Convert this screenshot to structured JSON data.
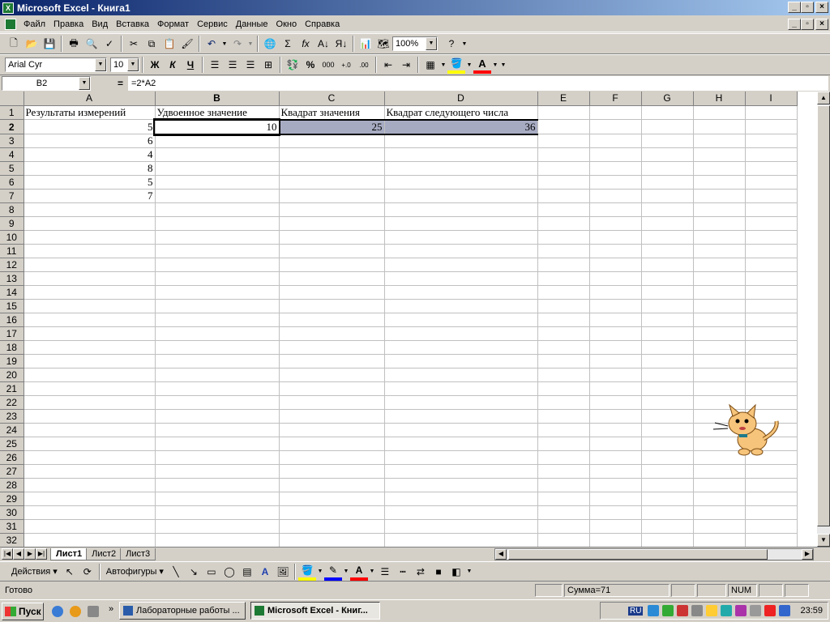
{
  "window": {
    "title": "Microsoft Excel - Книга1"
  },
  "menu": [
    "Файл",
    "Правка",
    "Вид",
    "Вставка",
    "Формат",
    "Сервис",
    "Данные",
    "Окно",
    "Справка"
  ],
  "toolbar": {
    "zoom": "100%",
    "sum_icon": "Σ",
    "fx_icon": "fx"
  },
  "format_bar": {
    "font": "Arial Cyr",
    "size": "10",
    "bold": "Ж",
    "italic": "К",
    "underline": "Ч",
    "percent": "%",
    "thousands": "000"
  },
  "formula_bar": {
    "name_box": "B2",
    "equals": "=",
    "formula": "=2*A2"
  },
  "grid": {
    "columns": [
      "A",
      "B",
      "C",
      "D",
      "E",
      "F",
      "G",
      "H",
      "I"
    ],
    "active_col": "B",
    "active_row": 2,
    "row_count": 32,
    "cells": {
      "A1": "Результаты измерений",
      "B1": "Удвоенное значение",
      "C1": "Квадрат значения",
      "D1": "Квадрат следующего числа",
      "A2": "5",
      "B2": "10",
      "C2": "25",
      "D2": "36",
      "A3": "6",
      "A4": "4",
      "A5": "8",
      "A6": "5",
      "A7": "7"
    }
  },
  "sheets": [
    "Лист1",
    "Лист2",
    "Лист3"
  ],
  "draw_bar": {
    "actions": "Действия ▾",
    "autoshapes": "Автофигуры ▾"
  },
  "status": {
    "ready": "Готово",
    "sum": "Сумма=71",
    "num": "NUM"
  },
  "taskbar": {
    "start": "Пуск",
    "tasks": [
      "Лабораторные работы ...",
      "Microsoft Excel - Книг..."
    ],
    "lang": "RU",
    "clock": "23:59"
  }
}
